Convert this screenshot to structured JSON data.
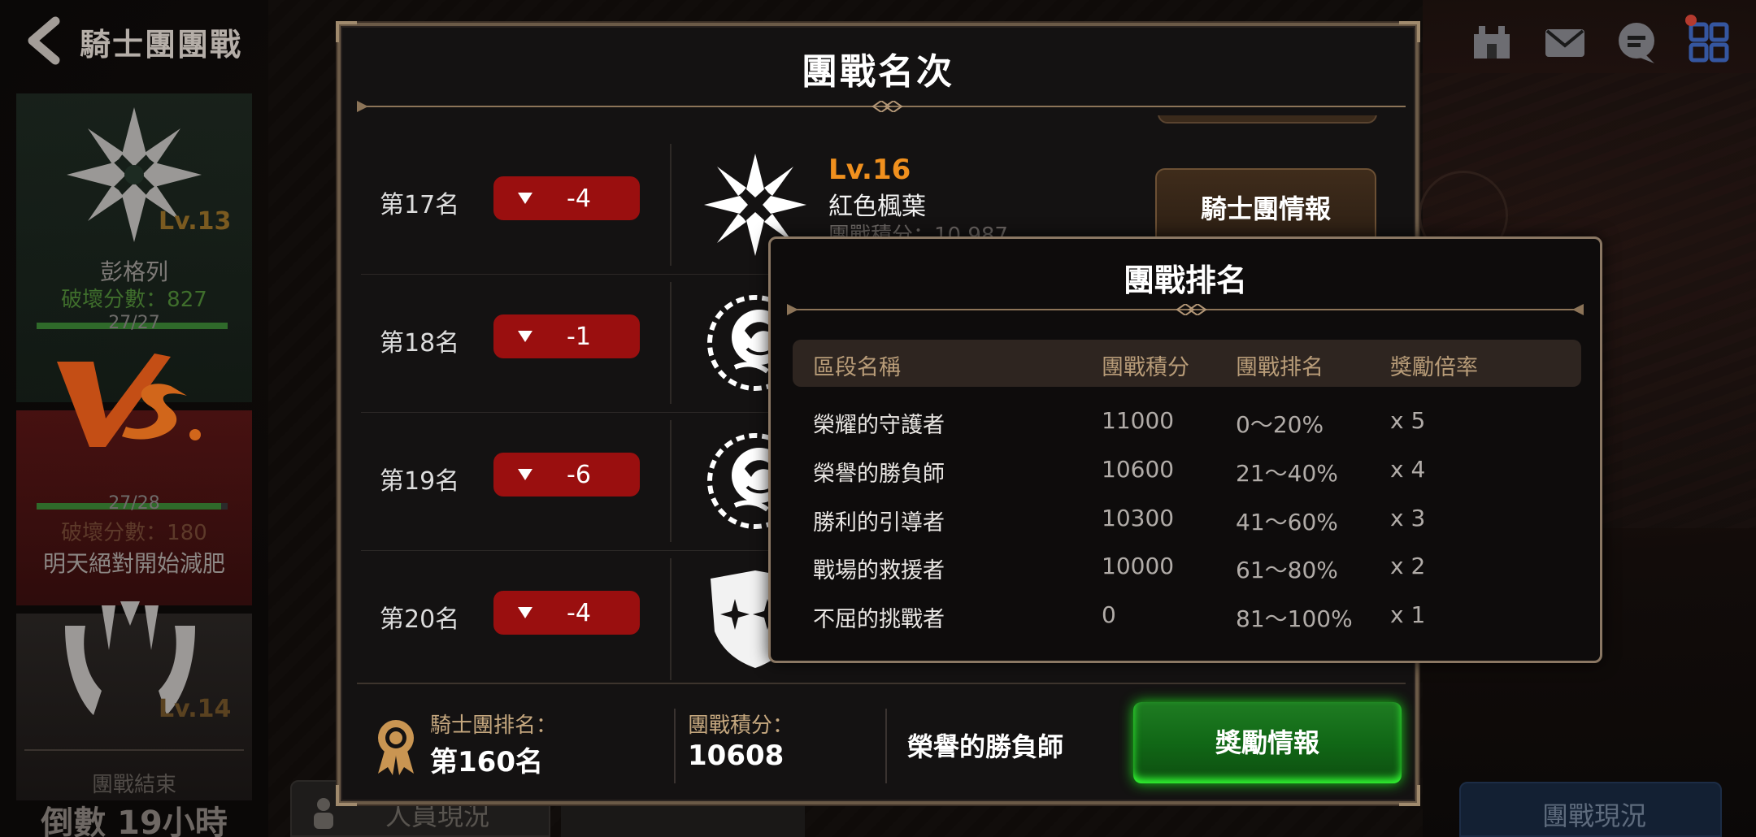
{
  "header": {
    "title": "騎士團團戰"
  },
  "left_panel": {
    "our_guild": {
      "level": "Lv.13",
      "name": "彭格列",
      "damage_score": "破壞分數：827",
      "progress_text": "27/27",
      "progress": 1.0
    },
    "enemy_guild": {
      "level": "Lv.14",
      "name": "明天絕對開始減肥",
      "damage_score": "破壞分數：180",
      "progress_text": "27/28",
      "progress": 0.964
    },
    "battle_end_label": "團戰結束",
    "countdown": "倒數 19小時"
  },
  "bottom_tabs": {
    "members": "人員現況",
    "status": "團戰現況"
  },
  "dialog": {
    "title": "團戰名次",
    "rows": [
      {
        "rank": "第17名",
        "change": "-4",
        "lv": "Lv.16",
        "name": "紅色楓葉",
        "score": "團戰積分：10,987",
        "btn": "騎士團情報",
        "emblem": "snowflake-emblem-icon"
      },
      {
        "rank": "第18名",
        "change": "-1",
        "emblem": "rose-emblem-icon"
      },
      {
        "rank": "第19名",
        "change": "-6",
        "emblem": "rose-emblem-icon"
      },
      {
        "rank": "第20名",
        "change": "-4",
        "emblem": "shield-emblem-icon"
      }
    ],
    "footer": {
      "rank_label": "騎士團排名：",
      "rank_value": "第160名",
      "score_label": "團戰積分：",
      "score_value": "10608",
      "tier": "榮譽的勝負師",
      "reward_button": "獎勵情報"
    }
  },
  "popup": {
    "title": "團戰排名",
    "columns": [
      "區段名稱",
      "團戰積分",
      "團戰排名",
      "獎勵倍率"
    ],
    "rows": [
      [
        "榮耀的守護者",
        "11000",
        "0～20%",
        "x 5"
      ],
      [
        "榮譽的勝負師",
        "10600",
        "21～40%",
        "x 4"
      ],
      [
        "勝利的引導者",
        "10300",
        "41～60%",
        "x 3"
      ],
      [
        "戰場的救援者",
        "10000",
        "61～80%",
        "x 2"
      ],
      [
        "不屈的挑戰者",
        "0",
        "81～100%",
        "x 1"
      ]
    ]
  },
  "colors": {
    "badge_red": "#9a0f0f",
    "level_orange": "#f0901e",
    "reward_green": "#1f7c22",
    "gold_border": "#8a7763"
  }
}
